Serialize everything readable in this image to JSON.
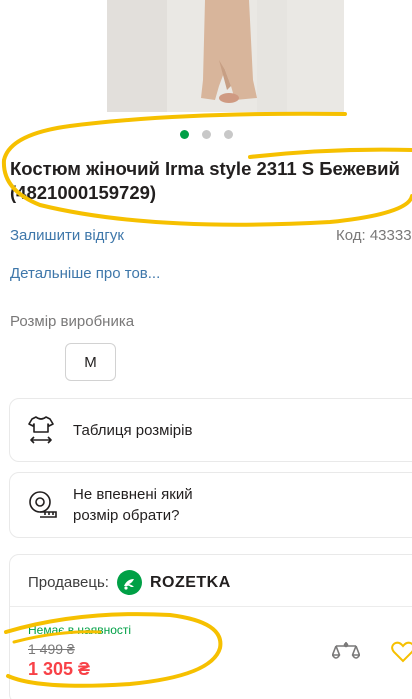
{
  "gallery": {
    "slide_count": 3,
    "active_index": 0
  },
  "product": {
    "title_line1": "Костюм жіночий Irma style 2311 S Бежевий",
    "title_line2": "(4821000159729)"
  },
  "links": {
    "review": "Залишити відгук",
    "code": "Код: 43333",
    "details": "Детальніше про тов..."
  },
  "size": {
    "label": "Розмір виробника",
    "selected": "M"
  },
  "cards": {
    "size_table": "Таблиця розмірів",
    "size_help_line1": "Не впевнені який",
    "size_help_line2": "розмір обрати?"
  },
  "seller": {
    "label": "Продавець:",
    "name": "ROZETKA",
    "status": "Немає в наявності",
    "old_price": "1 499 ₴",
    "price": "1 305 ₴"
  },
  "colors": {
    "link": "#3e77aa",
    "brand_green": "#00a046",
    "price_red": "#f84147",
    "annotation": "#f6c000"
  },
  "icons": [
    "shirt-ruler-icon",
    "tape-measure-icon",
    "rozetka-logo-icon",
    "compare-scales-icon",
    "heart-icon"
  ]
}
